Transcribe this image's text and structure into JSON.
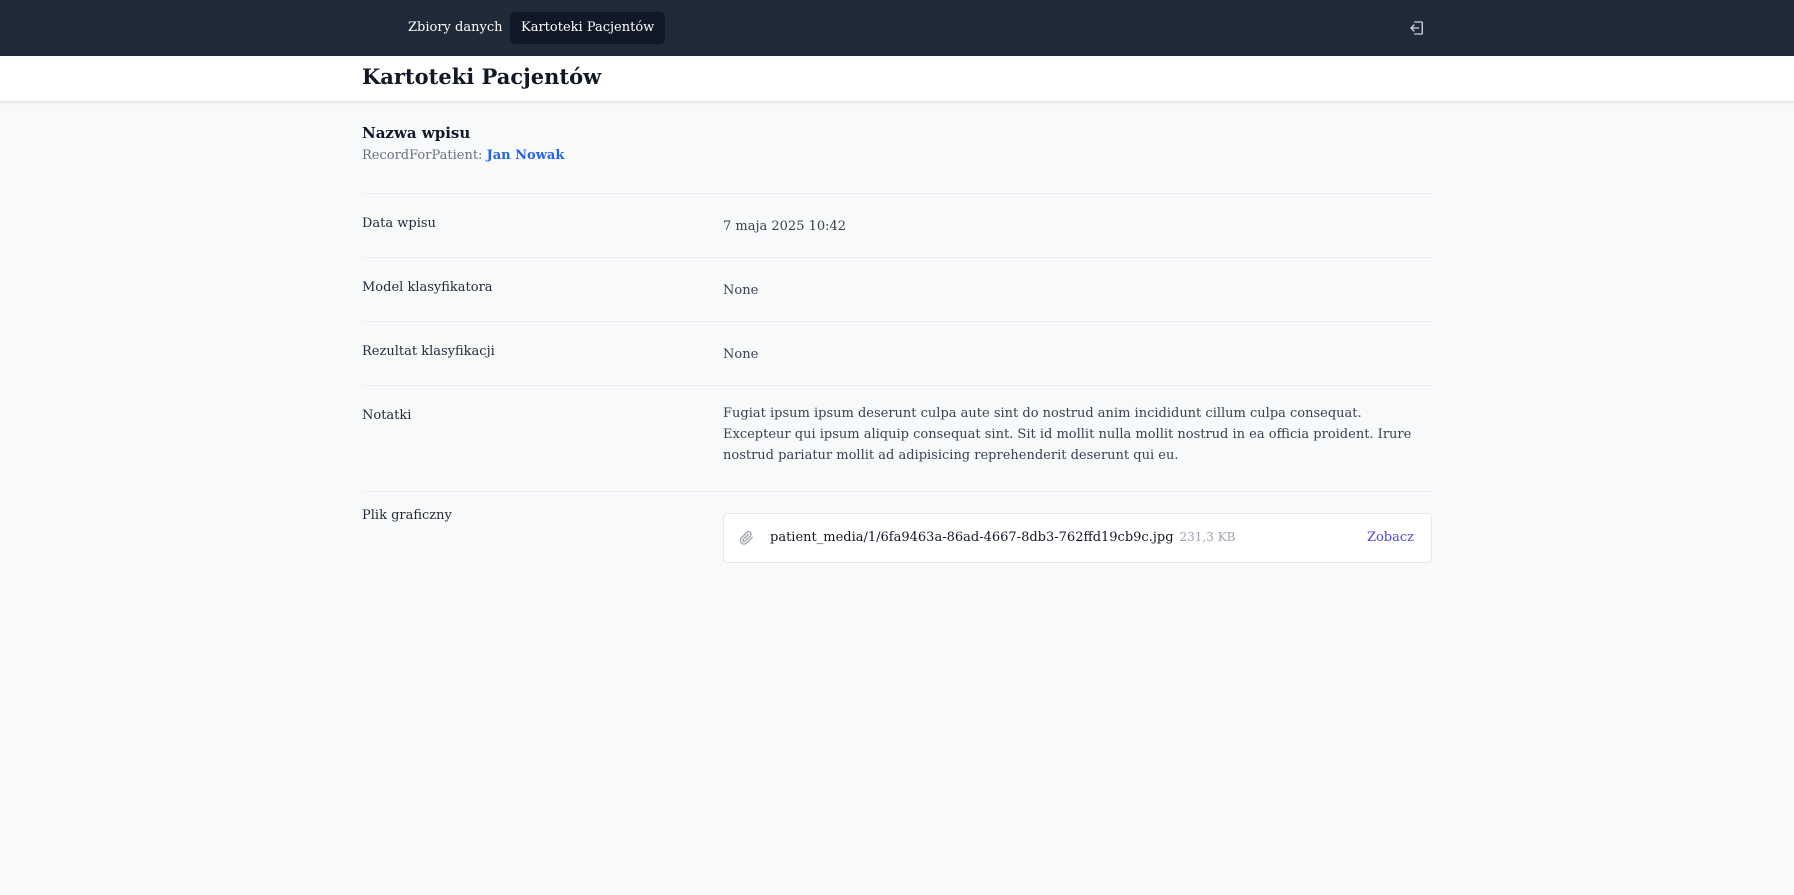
{
  "nav": {
    "items": [
      {
        "label": "Zbiory danych",
        "active": false
      },
      {
        "label": "Kartoteki Pacjentów",
        "active": true
      }
    ],
    "logout_icon": "logout-icon"
  },
  "header": {
    "title": "Kartoteki Pacjentów"
  },
  "record": {
    "name": "Nazwa wpisu",
    "patient_prefix": "RecordForPatient:",
    "patient_name": "Jan Nowak"
  },
  "fields": {
    "date": {
      "label": "Data wpisu",
      "value": "7 maja 2025 10:42"
    },
    "model": {
      "label": "Model klasyfikatora",
      "value": "None"
    },
    "result": {
      "label": "Rezultat klasyfikacji",
      "value": "None"
    },
    "notes": {
      "label": "Notatki",
      "value": "Fugiat ipsum ipsum deserunt culpa aute sint do nostrud anim incididunt cillum culpa consequat. Excepteur qui ipsum aliquip consequat sint. Sit id mollit nulla mollit nostrud in ea officia proident. Irure nostrud pariatur mollit ad adipisicing reprehenderit deserunt qui eu."
    },
    "file": {
      "label": "Plik graficzny",
      "filename": "patient_media/1/6fa9463a-86ad-4667-8db3-762ffd19cb9c.jpg",
      "size": "231,3 KB",
      "view_label": "Zobacz",
      "icon": "paperclip-icon"
    }
  },
  "colors": {
    "nav_bg": "#1f2937",
    "nav_active_bg": "#111827",
    "page_bg": "#f8f9fb",
    "link_blue": "#2563eb",
    "link_indigo": "#4f46e5"
  }
}
